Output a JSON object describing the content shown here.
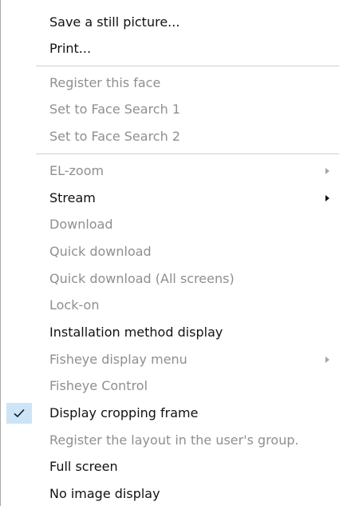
{
  "menu": {
    "items": [
      {
        "label": "Save a still picture...",
        "enabled": true
      },
      {
        "label": "Print...",
        "enabled": true
      },
      {
        "label": "Register this face",
        "enabled": false
      },
      {
        "label": "Set to Face Search 1",
        "enabled": false
      },
      {
        "label": "Set to Face Search 2",
        "enabled": false
      },
      {
        "label": "EL-zoom",
        "enabled": false,
        "submenu": true
      },
      {
        "label": "Stream",
        "enabled": true,
        "submenu": true
      },
      {
        "label": "Download",
        "enabled": false
      },
      {
        "label": "Quick download",
        "enabled": false
      },
      {
        "label": "Quick download (All screens)",
        "enabled": false
      },
      {
        "label": "Lock-on",
        "enabled": false
      },
      {
        "label": "Installation method display",
        "enabled": true
      },
      {
        "label": "Fisheye display menu",
        "enabled": false,
        "submenu": true
      },
      {
        "label": "Fisheye Control",
        "enabled": false
      },
      {
        "label": "Display cropping frame",
        "enabled": true,
        "checked": true
      },
      {
        "label": "Register the layout in the user's group.",
        "enabled": false
      },
      {
        "label": "Full screen",
        "enabled": true
      },
      {
        "label": "No image display",
        "enabled": true
      }
    ]
  },
  "colors": {
    "enabled_text": "#111111",
    "disabled_text": "#8f8f8f",
    "check_highlight": "#cce4f7",
    "check_mark": "#1a1a1a"
  },
  "icons": {
    "submenu": "chevron-right-icon",
    "check": "checkmark-icon"
  }
}
